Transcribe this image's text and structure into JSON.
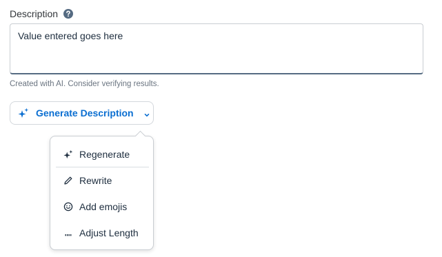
{
  "field": {
    "label": "Description",
    "help_icon": "help-circle-icon",
    "value": "Value entered goes here",
    "note": "Created with AI. Consider verifying results."
  },
  "generate_button": {
    "label": "Generate Description",
    "icon": "sparkle-icon",
    "dropdown_icon": "chevron-down-icon"
  },
  "menu": {
    "items": [
      {
        "label": "Regenerate",
        "icon": "sparkle-icon"
      },
      {
        "label": "Rewrite",
        "icon": "pencil-icon"
      },
      {
        "label": "Add emojis",
        "icon": "smiley-icon"
      },
      {
        "label": "Adjust Length",
        "icon": "dots-icon"
      }
    ]
  },
  "colors": {
    "accent": "#0a6ed1",
    "text": "#1d2d3e",
    "muted": "#6a7480",
    "border": "#c9cdd2",
    "help_icon": "#556b82"
  }
}
